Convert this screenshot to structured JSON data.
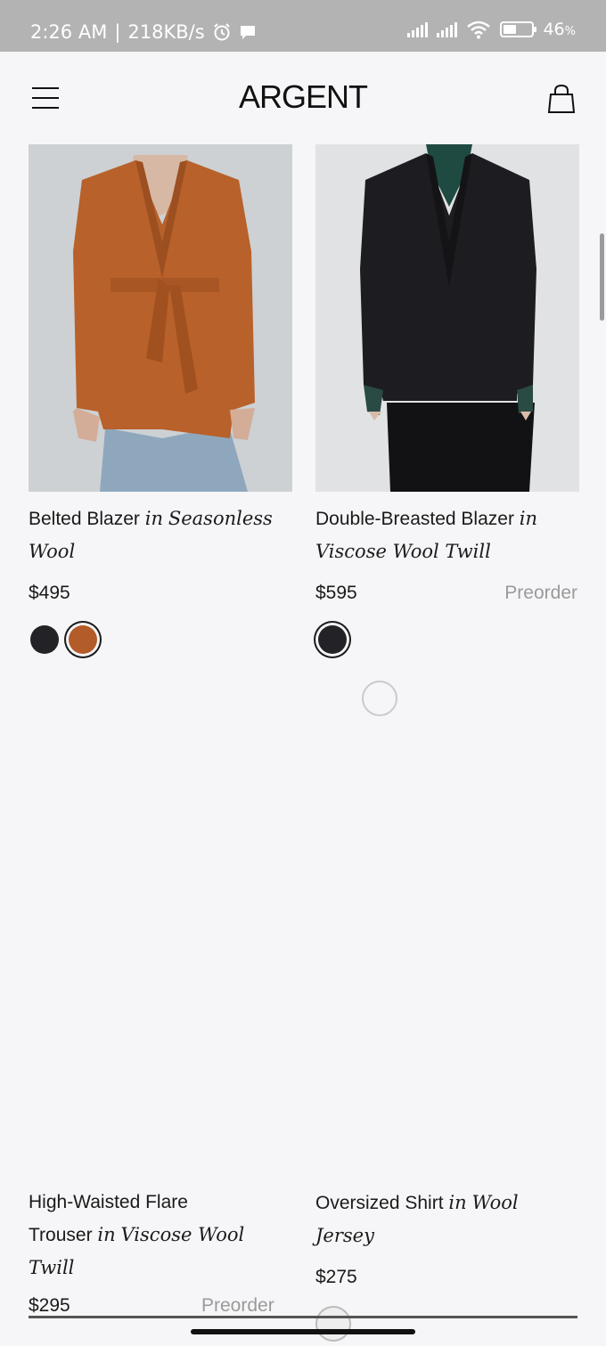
{
  "status_bar": {
    "time": "2:26 AM",
    "speed": "218KB/s",
    "battery_text": "46",
    "battery_percent_sign": "%",
    "battery_level": 0.46
  },
  "header": {
    "brand": "ARGENT"
  },
  "products": [
    {
      "name": "Belted Blazer",
      "connector": "in",
      "material_line1": "Seasonless",
      "material_line2": "Wool",
      "price": "$495",
      "status": "",
      "swatches": [
        {
          "color": "#232226",
          "selected": false
        },
        {
          "color": "#b45b2a",
          "selected": true
        }
      ]
    },
    {
      "name": "Double-Breasted Blazer",
      "connector": "in",
      "material_line1": "",
      "material_line2": "Viscose Wool Twill",
      "price": "$595",
      "status": "Preorder",
      "swatches": [
        {
          "color": "#232226",
          "selected": true
        }
      ]
    },
    {
      "name_line1": "High-Waisted Flare",
      "name_line2": "Trouser",
      "connector": "in",
      "material_line1": "Viscose Wool",
      "material_line2": "Twill",
      "price": "$295",
      "status": "Preorder"
    },
    {
      "name": "Oversized Shirt",
      "connector": "in",
      "material_line1": "Wool",
      "material_line2": "Jersey",
      "price": "$275",
      "status": ""
    }
  ],
  "icons": {
    "menu": "hamburger-menu-icon",
    "bag": "shopping-bag-icon",
    "alarm": "alarm-clock-icon",
    "message": "message-icon",
    "wifi": "wifi-icon",
    "battery": "battery-icon",
    "loading": "loading-spinner-icon"
  }
}
